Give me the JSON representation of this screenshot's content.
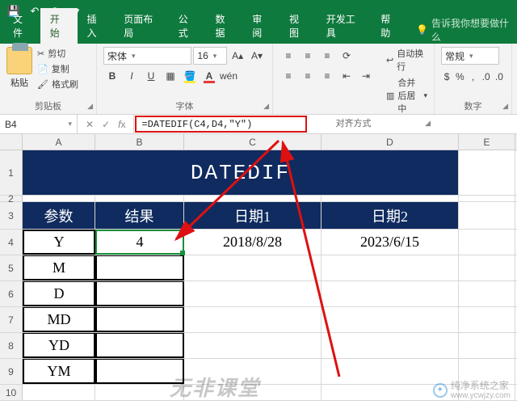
{
  "titlebar": {
    "qat": {
      "save": "💾",
      "undo": "↶",
      "redo": "↷",
      "more": "▾"
    }
  },
  "tabs": {
    "file": "文件",
    "home": "开始",
    "insert": "插入",
    "page_layout": "页面布局",
    "formulas": "公式",
    "data": "数据",
    "review": "审阅",
    "view": "视图",
    "dev": "开发工具",
    "help": "帮助",
    "tell_me": "告诉我你想要做什么"
  },
  "ribbon": {
    "clipboard": {
      "paste": "粘贴",
      "cut": "剪切",
      "copy": "复制",
      "format_painter": "格式刷",
      "group": "剪贴板"
    },
    "font": {
      "name": "宋体",
      "size": "16",
      "group": "字体"
    },
    "alignment": {
      "wrap": "自动换行",
      "merge": "合并后居中",
      "group": "对齐方式"
    },
    "number": {
      "format": "常规",
      "group": "数字"
    }
  },
  "name_box": "B4",
  "formula": "=DATEDIF(C4,D4,\"Y\")",
  "columns": [
    "A",
    "B",
    "C",
    "D",
    "E"
  ],
  "sheet": {
    "title_banner": "DATEDIF",
    "headers": {
      "a": "参数",
      "b": "结果",
      "c": "日期1",
      "d": "日期2"
    },
    "rows": [
      {
        "param": "Y",
        "result": "4",
        "date1": "2018/8/28",
        "date2": "2023/6/15"
      },
      {
        "param": "M",
        "result": "",
        "date1": "",
        "date2": ""
      },
      {
        "param": "D",
        "result": "",
        "date1": "",
        "date2": ""
      },
      {
        "param": "MD",
        "result": "",
        "date1": "",
        "date2": ""
      },
      {
        "param": "YD",
        "result": "",
        "date1": "",
        "date2": ""
      },
      {
        "param": "YM",
        "result": "",
        "date1": "",
        "date2": ""
      }
    ]
  },
  "row_numbers": [
    "1",
    "2",
    "3",
    "4",
    "5",
    "6",
    "7",
    "8",
    "9",
    "10"
  ],
  "watermark1": "无非课堂",
  "watermark2": "纯净系统之家",
  "watermark2_url": "www.ycwjzy.com"
}
